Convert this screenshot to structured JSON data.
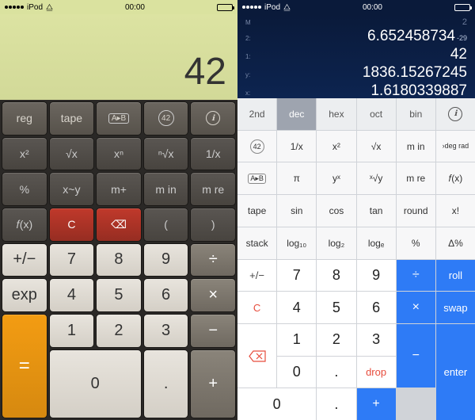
{
  "status": {
    "carrier": "iPod",
    "time": "00:00",
    "wifi": "wifi-icon",
    "battery": "battery-icon"
  },
  "left": {
    "display": "42",
    "row0": [
      "reg",
      "tape",
      "A▸B",
      "42",
      "ℹ"
    ],
    "row1": [
      "x²",
      "√x",
      "xⁿ",
      "ⁿ√x",
      "1/x"
    ],
    "row2": [
      "%",
      "x~y",
      "m+",
      "m in",
      "m re"
    ],
    "row3": [
      "𝑓(x)",
      "C",
      "⌫",
      "(",
      ")"
    ],
    "row4": [
      "+/−",
      "7",
      "8",
      "9",
      "÷"
    ],
    "row5": [
      "exp",
      "4",
      "5",
      "6",
      "×"
    ],
    "row6": [
      "=",
      "1",
      "2",
      "3",
      "−"
    ],
    "row7": [
      "0",
      ".",
      "+"
    ]
  },
  "right": {
    "display": [
      {
        "lbl": "M",
        "val": "2",
        "sup": ""
      },
      {
        "lbl": "2:",
        "val": "6.652458734",
        "sup": "-29"
      },
      {
        "lbl": "1:",
        "val": "42",
        "sup": ""
      },
      {
        "lbl": "y:",
        "val": "1836.15267245",
        "sup": ""
      },
      {
        "lbl": "x:",
        "val": "1.6180339887",
        "sup": ""
      }
    ],
    "r0": [
      "2nd",
      "dec",
      "hex",
      "oct",
      "bin",
      "ℹ"
    ],
    "r1": [
      "42",
      "1/x",
      "x²",
      "√x",
      "m in",
      "›deg rad"
    ],
    "r2": [
      "A▸B",
      "π",
      "yˣ",
      "ˣ√y",
      "m re",
      "𝑓(x)"
    ],
    "r3": [
      "tape",
      "sin",
      "cos",
      "tan",
      "round",
      "x!"
    ],
    "r4": [
      "stack",
      "log₁₀",
      "log₂",
      "logₑ",
      "%",
      "Δ%"
    ],
    "r5": [
      "+/−",
      "7",
      "8",
      "9",
      "÷",
      "roll"
    ],
    "r6": [
      "C",
      "4",
      "5",
      "6",
      "×",
      "swap"
    ],
    "r7": [
      "1",
      "2",
      "3",
      "−"
    ],
    "r8": [
      "drop",
      "0",
      ".",
      "+",
      "enter"
    ]
  }
}
